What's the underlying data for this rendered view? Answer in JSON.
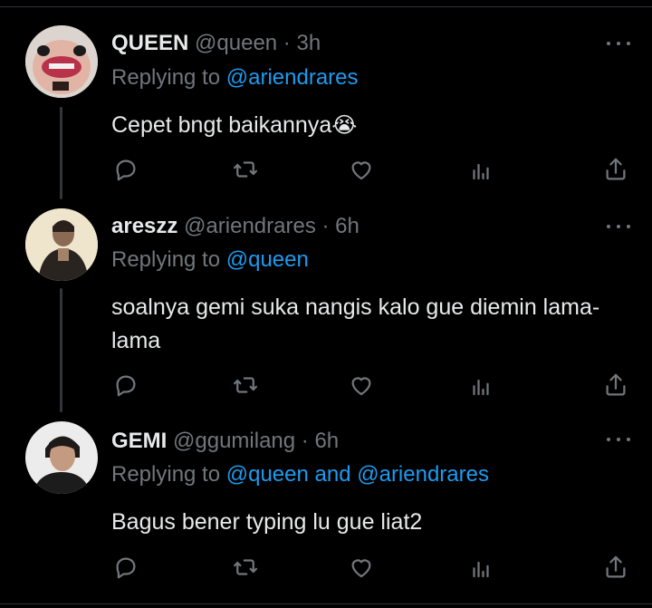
{
  "tweets": [
    {
      "name": "QUEEN",
      "handle": "@queen",
      "time": "3h",
      "replying_prefix": "Replying to ",
      "replying_to": "@ariendrares",
      "text": "Cepet bngt baikannya",
      "emoji": "😭"
    },
    {
      "name": "areszz",
      "handle": "@ariendrares",
      "time": "6h",
      "replying_prefix": "Replying to ",
      "replying_to": "@queen",
      "text": "soalnya gemi suka nangis kalo gue diemin lama-lama"
    },
    {
      "name": "GEMI",
      "handle": "@ggumilang",
      "time": "6h",
      "replying_prefix": "Replying to ",
      "replying_to": "@queen and @ariendrares",
      "text": "Bagus bener typing lu gue liat2"
    }
  ],
  "separator": " · ",
  "colors": {
    "background": "#000000",
    "text": "#e7e9ea",
    "muted": "#71767b",
    "link": "#1d9bf0",
    "divider": "#2f3336"
  },
  "icons": [
    "reply-icon",
    "retweet-icon",
    "like-icon",
    "views-icon",
    "share-icon",
    "more-icon"
  ]
}
